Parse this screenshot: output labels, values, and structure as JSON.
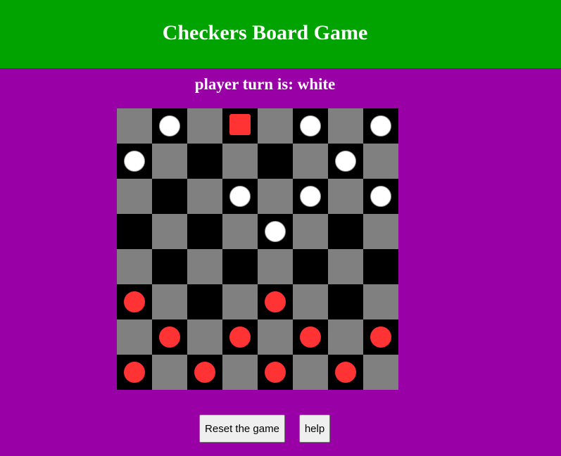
{
  "header": {
    "title": "Checkers Board Game",
    "background": "#00a300"
  },
  "status": {
    "label": "player turn is:",
    "player": "white"
  },
  "board": {
    "size": 8,
    "light_color": "#808080",
    "dark_color": "#000000",
    "pieces": [
      {
        "row": 0,
        "col": 1,
        "color": "white",
        "king": false
      },
      {
        "row": 0,
        "col": 3,
        "color": "red",
        "king": true
      },
      {
        "row": 0,
        "col": 5,
        "color": "white",
        "king": false
      },
      {
        "row": 0,
        "col": 7,
        "color": "white",
        "king": false
      },
      {
        "row": 1,
        "col": 0,
        "color": "white",
        "king": false
      },
      {
        "row": 1,
        "col": 6,
        "color": "white",
        "king": false
      },
      {
        "row": 2,
        "col": 3,
        "color": "white",
        "king": false
      },
      {
        "row": 2,
        "col": 5,
        "color": "white",
        "king": false
      },
      {
        "row": 2,
        "col": 7,
        "color": "white",
        "king": false
      },
      {
        "row": 3,
        "col": 4,
        "color": "white",
        "king": false
      },
      {
        "row": 5,
        "col": 0,
        "color": "red",
        "king": false
      },
      {
        "row": 5,
        "col": 4,
        "color": "red",
        "king": false
      },
      {
        "row": 6,
        "col": 1,
        "color": "red",
        "king": false
      },
      {
        "row": 6,
        "col": 3,
        "color": "red",
        "king": false
      },
      {
        "row": 6,
        "col": 5,
        "color": "red",
        "king": false
      },
      {
        "row": 6,
        "col": 7,
        "color": "red",
        "king": false
      },
      {
        "row": 7,
        "col": 0,
        "color": "red",
        "king": false
      },
      {
        "row": 7,
        "col": 2,
        "color": "red",
        "king": false
      },
      {
        "row": 7,
        "col": 4,
        "color": "red",
        "king": false
      },
      {
        "row": 7,
        "col": 6,
        "color": "red",
        "king": false
      }
    ]
  },
  "buttons": {
    "reset_label": "Reset the game",
    "help_label": "help"
  },
  "colors": {
    "background": "#9900a6",
    "white_piece": "#ffffff",
    "red_piece": "#ff3333"
  }
}
